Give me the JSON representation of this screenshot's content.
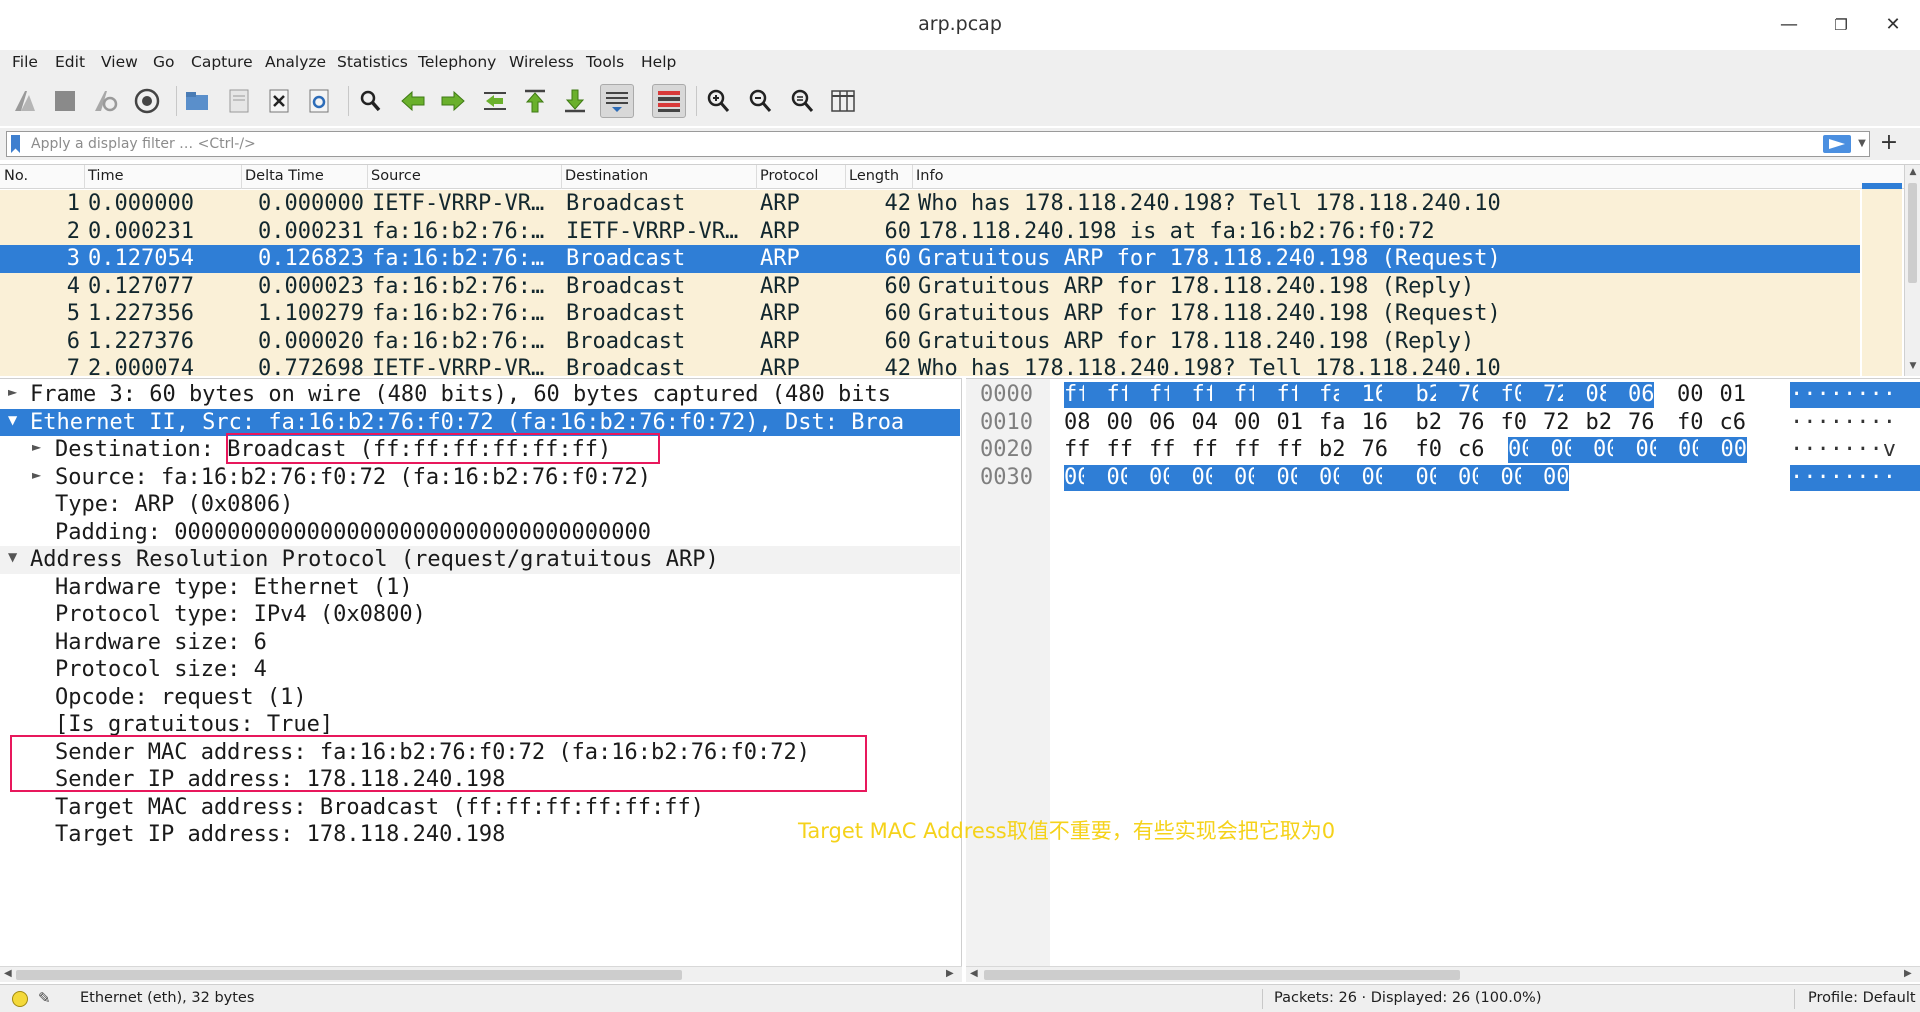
{
  "window": {
    "title": "arp.pcap"
  },
  "menu": [
    "File",
    "Edit",
    "View",
    "Go",
    "Capture",
    "Analyze",
    "Statistics",
    "Telephony",
    "Wireless",
    "Tools",
    "Help"
  ],
  "filter": {
    "placeholder": "Apply a display filter … <Ctrl-/>"
  },
  "packet_list": {
    "columns": [
      "No.",
      "Time",
      "Delta Time",
      "Source",
      "Destination",
      "Protocol",
      "Length",
      "Info"
    ],
    "rows": [
      {
        "no": "1",
        "time": "0.000000",
        "delta": "0.000000",
        "src": "IETF-VRRP-VR…",
        "dst": "Broadcast",
        "proto": "ARP",
        "len": "42",
        "info": "Who has 178.118.240.198? Tell 178.118.240.10"
      },
      {
        "no": "2",
        "time": "0.000231",
        "delta": "0.000231",
        "src": "fa:16:b2:76:…",
        "dst": "IETF-VRRP-VR…",
        "proto": "ARP",
        "len": "60",
        "info": "178.118.240.198 is at fa:16:b2:76:f0:72"
      },
      {
        "no": "3",
        "time": "0.127054",
        "delta": "0.126823",
        "src": "fa:16:b2:76:…",
        "dst": "Broadcast",
        "proto": "ARP",
        "len": "60",
        "info": "Gratuitous ARP for 178.118.240.198 (Request)"
      },
      {
        "no": "4",
        "time": "0.127077",
        "delta": "0.000023",
        "src": "fa:16:b2:76:…",
        "dst": "Broadcast",
        "proto": "ARP",
        "len": "60",
        "info": "Gratuitous ARP for 178.118.240.198 (Reply)"
      },
      {
        "no": "5",
        "time": "1.227356",
        "delta": "1.100279",
        "src": "fa:16:b2:76:…",
        "dst": "Broadcast",
        "proto": "ARP",
        "len": "60",
        "info": "Gratuitous ARP for 178.118.240.198 (Request)"
      },
      {
        "no": "6",
        "time": "1.227376",
        "delta": "0.000020",
        "src": "fa:16:b2:76:…",
        "dst": "Broadcast",
        "proto": "ARP",
        "len": "60",
        "info": "Gratuitous ARP for 178.118.240.198 (Reply)"
      },
      {
        "no": "7",
        "time": "2.000074",
        "delta": "0.772698",
        "src": "IETF-VRRP-VR…",
        "dst": "Broadcast",
        "proto": "ARP",
        "len": "42",
        "info": "Who has 178.118.240.198? Tell 178.118.240.10"
      }
    ]
  },
  "details": [
    "Frame 3: 60 bytes on wire (480 bits), 60 bytes captured (480 bits",
    "Ethernet II, Src: fa:16:b2:76:f0:72 (fa:16:b2:76:f0:72), Dst: Broa",
    "Destination: Broadcast (ff:ff:ff:ff:ff:ff)",
    "Source: fa:16:b2:76:f0:72 (fa:16:b2:76:f0:72)",
    "Type: ARP (0x0806)",
    "Padding: 000000000000000000000000000000000000",
    "Address Resolution Protocol (request/gratuitous ARP)",
    "Hardware type: Ethernet (1)",
    "Protocol type: IPv4 (0x0800)",
    "Hardware size: 6",
    "Protocol size: 4",
    "Opcode: request (1)",
    "[Is gratuitous: True]",
    "Sender MAC address: fa:16:b2:76:f0:72 (fa:16:b2:76:f0:72)",
    "Sender IP address: 178.118.240.198",
    "Target MAC address: Broadcast (ff:ff:ff:ff:ff:ff)",
    "Target IP address: 178.118.240.198"
  ],
  "hex": [
    {
      "offset": "0000",
      "bytes": [
        "ff",
        "ff",
        "ff",
        "ff",
        "ff",
        "ff",
        "fa",
        "16",
        "b2",
        "76",
        "f0",
        "72",
        "08",
        "06",
        "00",
        "01"
      ],
      "ascii": "········"
    },
    {
      "offset": "0010",
      "bytes": [
        "08",
        "00",
        "06",
        "04",
        "00",
        "01",
        "fa",
        "16",
        "b2",
        "76",
        "f0",
        "72",
        "b2",
        "76",
        "f0",
        "c6"
      ],
      "ascii": "········"
    },
    {
      "offset": "0020",
      "bytes": [
        "ff",
        "ff",
        "ff",
        "ff",
        "ff",
        "ff",
        "b2",
        "76",
        "f0",
        "c6",
        "00",
        "00",
        "00",
        "00",
        "00",
        "00"
      ],
      "ascii": "·······v"
    },
    {
      "offset": "0030",
      "bytes": [
        "00",
        "00",
        "00",
        "00",
        "00",
        "00",
        "00",
        "00",
        "00",
        "00",
        "00",
        "00"
      ],
      "ascii": "········"
    }
  ],
  "annotation": "Target MAC Address取值不重要，有些实现会把它取为0",
  "status": {
    "field": "Ethernet (eth), 32 bytes",
    "packets": "Packets: 26 · Displayed: 26 (100.0%)",
    "profile": "Profile: Default"
  },
  "colors": {
    "selection": "#2f7ed6",
    "arp_row": "#faf0d7",
    "annotation_box": "#e8185c",
    "annotation_text": "#f5d21a"
  }
}
